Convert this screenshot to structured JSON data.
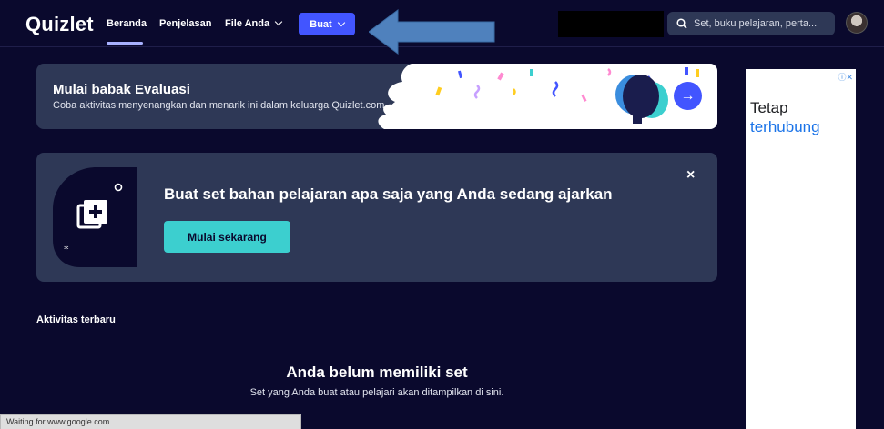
{
  "nav": {
    "logo": "Quizlet",
    "items": [
      "Beranda",
      "Penjelasan",
      "File Anda"
    ],
    "create_label": "Buat",
    "search_placeholder": "Set, buku pelajaran, perta..."
  },
  "banner_evaluation": {
    "title": "Mulai babak Evaluasi",
    "subtitle": "Coba aktivitas menyenangkan dan menarik ini dalam keluarga Quizlet.com"
  },
  "banner_create": {
    "title": "Buat set bahan pelajaran apa saja yang Anda sedang ajarkan",
    "button_label": "Mulai sekarang",
    "close_label": "×"
  },
  "ad": {
    "line1": "Tetap",
    "line2": "terhubung"
  },
  "recent": {
    "title": "Aktivitas terbaru",
    "empty_title": "Anda belum memiliki set",
    "empty_subtitle": "Set yang Anda buat atau pelajari akan ditampilkan di sini."
  },
  "status_bar": {
    "text": "Waiting for www.google.com..."
  },
  "colors": {
    "background": "#0a092d",
    "card": "#2e3856",
    "primary": "#4255ff",
    "accent_teal": "#3ccfcf"
  }
}
